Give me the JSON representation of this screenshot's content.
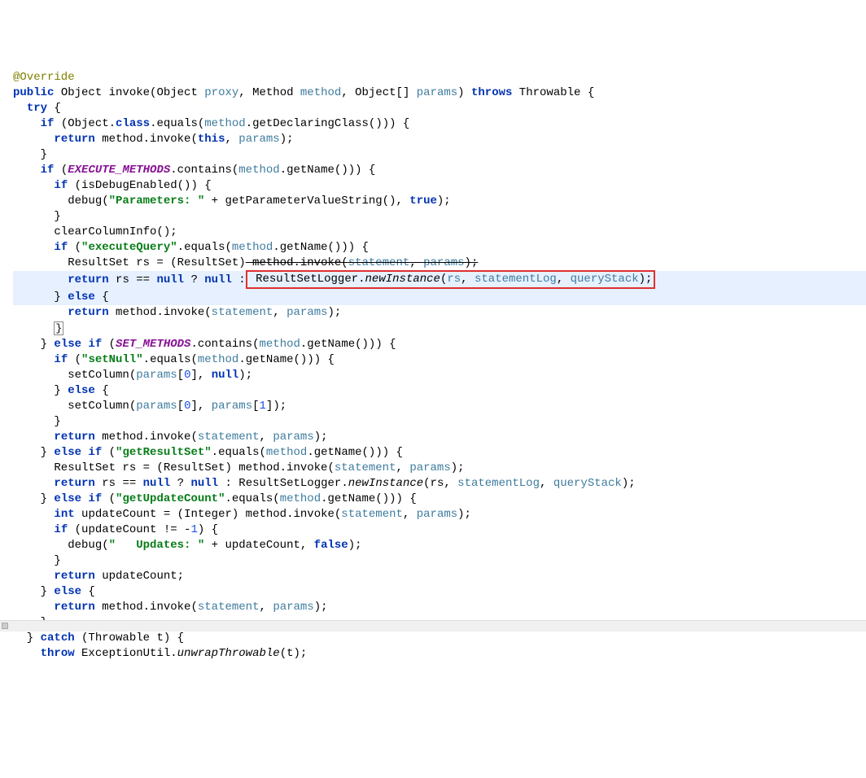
{
  "code": {
    "l1": "@Override",
    "l2a": "public",
    "l2b": " Object invoke(Object ",
    "l2c": "proxy",
    "l2d": ", Method ",
    "l2e": "method",
    "l2f": ", Object[] ",
    "l2g": "params",
    "l2h": ") ",
    "l2i": "throws",
    "l2j": " Throwable {",
    "l3a": "  ",
    "l3b": "try",
    "l3c": " {",
    "l4a": "    ",
    "l4b": "if",
    "l4c": " (Object.",
    "l4d": "class",
    "l4e": ".equals(",
    "l4f": "method",
    "l4g": ".getDeclaringClass())) {",
    "l5a": "      ",
    "l5b": "return",
    "l5c": " method.invoke(",
    "l5d": "this",
    "l5e": ", ",
    "l5f": "params",
    "l5g": ");",
    "l6": "    }",
    "l7a": "    ",
    "l7b": "if",
    "l7c": " (",
    "l7d": "EXECUTE_METHODS",
    "l7e": ".contains(",
    "l7f": "method",
    "l7g": ".getName())) {",
    "l8a": "      ",
    "l8b": "if",
    "l8c": " (isDebugEnabled()) {",
    "l9a": "        debug(",
    "l9b": "\"Parameters: \"",
    "l9c": " + getParameterValueString(), ",
    "l9d": "true",
    "l9e": ");",
    "l10": "      }",
    "l11": "      clearColumnInfo();",
    "l12a": "      ",
    "l12b": "if",
    "l12c": " (",
    "l12d": "\"executeQuery\"",
    "l12e": ".equals(",
    "l12f": "method",
    "l12g": ".getName())) {",
    "l13a": "        ResultSet rs = (ResultSet)",
    "l13b": " method.invoke(",
    "l13c": "statement",
    "l13d": ", ",
    "l13e": "params",
    "l13f": ");",
    "l14a": "return",
    "l14b": " rs == ",
    "l14c": "null",
    "l14d": " ? ",
    "l14e": "null",
    "l14f": " :",
    "l14g": " ResultSetLogger.",
    "l14h": "newInstance",
    "l14i": "(",
    "l14j": "rs",
    "l14k": ", ",
    "l14l": "statementLog",
    "l14m": ", ",
    "l14n": "queryStack",
    "l14o": ");",
    "l15a": "      } ",
    "l15b": "else",
    "l15c": " {",
    "l16a": "        ",
    "l16b": "return",
    "l16c": " method.invoke(",
    "l16d": "statement",
    "l16e": ", ",
    "l16f": "params",
    "l16g": ");",
    "l17a": "      ",
    "l17b": "}",
    "l18a": "    } ",
    "l18b": "else if",
    "l18c": " (",
    "l18d": "SET_METHODS",
    "l18e": ".contains(",
    "l18f": "method",
    "l18g": ".getName())) {",
    "l19a": "      ",
    "l19b": "if",
    "l19c": " (",
    "l19d": "\"setNull\"",
    "l19e": ".equals(",
    "l19f": "method",
    "l19g": ".getName())) {",
    "l20a": "        setColumn(",
    "l20b": "params",
    "l20c": "[",
    "l20d": "0",
    "l20e": "], ",
    "l20f": "null",
    "l20g": ");",
    "l21a": "      } ",
    "l21b": "else",
    "l21c": " {",
    "l22a": "        setColumn(",
    "l22b": "params",
    "l22c": "[",
    "l22d": "0",
    "l22e": "], ",
    "l22f": "params",
    "l22g": "[",
    "l22h": "1",
    "l22i": "]);",
    "l23": "      }",
    "l24a": "      ",
    "l24b": "return",
    "l24c": " method.invoke(",
    "l24d": "statement",
    "l24e": ", ",
    "l24f": "params",
    "l24g": ");",
    "l25a": "    } ",
    "l25b": "else if",
    "l25c": " (",
    "l25d": "\"getResultSet\"",
    "l25e": ".equals(",
    "l25f": "method",
    "l25g": ".getName())) {",
    "l26a": "      ResultSet rs = (ResultSet) method.invoke(",
    "l26b": "statement",
    "l26c": ", ",
    "l26d": "params",
    "l26e": ");",
    "l27a": "      ",
    "l27b": "return",
    "l27c": " rs == ",
    "l27d": "null",
    "l27e": " ? ",
    "l27f": "null",
    "l27g": " : ResultSetLogger.",
    "l27h": "newInstance",
    "l27i": "(rs, ",
    "l27j": "statementLog",
    "l27k": ", ",
    "l27l": "queryStack",
    "l27m": ");",
    "l28a": "    } ",
    "l28b": "else if",
    "l28c": " (",
    "l28d": "\"getUpdateCount\"",
    "l28e": ".equals(",
    "l28f": "method",
    "l28g": ".getName())) {",
    "l29a": "      ",
    "l29b": "int",
    "l29c": " updateCount = (Integer) method.invoke(",
    "l29d": "statement",
    "l29e": ", ",
    "l29f": "params",
    "l29g": ");",
    "l30a": "      ",
    "l30b": "if",
    "l30c": " (updateCount != -",
    "l30d": "1",
    "l30e": ") {",
    "l31a": "        debug(",
    "l31b": "\"   Updates: \"",
    "l31c": " + updateCount, ",
    "l31d": "false",
    "l31e": ");",
    "l32": "      }",
    "l33a": "      ",
    "l33b": "return",
    "l33c": " updateCount;",
    "l34a": "    } ",
    "l34b": "else",
    "l34c": " {",
    "l35a": "      ",
    "l35b": "return",
    "l35c": " method.invoke(",
    "l35d": "statement",
    "l35e": ", ",
    "l35f": "params",
    "l35g": ");",
    "l36": "    }",
    "l37a": "  } ",
    "l37b": "catch",
    "l37c": " (Throwable t) {",
    "l38a": "    ",
    "l38b": "throw",
    "l38c": " ExceptionUtil.",
    "l38d": "unwrapThrowable",
    "l38e": "(t);"
  }
}
